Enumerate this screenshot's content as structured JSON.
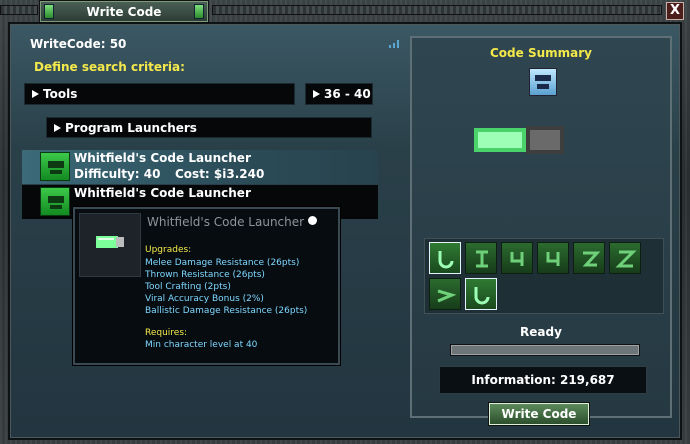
{
  "window": {
    "title": "Write Code",
    "close_label": "X"
  },
  "header": {
    "write_code_label": "WriteCode: 50",
    "search_criteria_label": "Define search criteria:"
  },
  "filters": {
    "category": "Tools",
    "level_range": "36 - 40",
    "subcategory": "Program Launchers"
  },
  "results": [
    {
      "name": "Whitfield's Code Launcher",
      "difficulty": "Difficulty: 40",
      "cost": "Cost: $i3.240"
    },
    {
      "name": "Whitfield's Code Launcher"
    }
  ],
  "tooltip": {
    "title": "Whitfield's Code Launcher",
    "upgrades_label": "Upgrades:",
    "upgrades": [
      "Melee Damage Resistance (26pts)",
      "Thrown Resistance (26pts)",
      "Tool Crafting (2pts)",
      "Viral Accuracy Bonus (2%)",
      "Ballistic Damage Resistance (26pts)"
    ],
    "requires_label": "Requires:",
    "requires": "Min character level at 40"
  },
  "summary": {
    "title": "Code Summary",
    "status": "Ready",
    "progress": 0,
    "information": "Information: 219,687",
    "write_button": "Write Code"
  },
  "colors": {
    "accent_yellow": "#f4e94a",
    "code_green": "#2fb83d",
    "tooltip_blue": "#7fd8ff"
  }
}
